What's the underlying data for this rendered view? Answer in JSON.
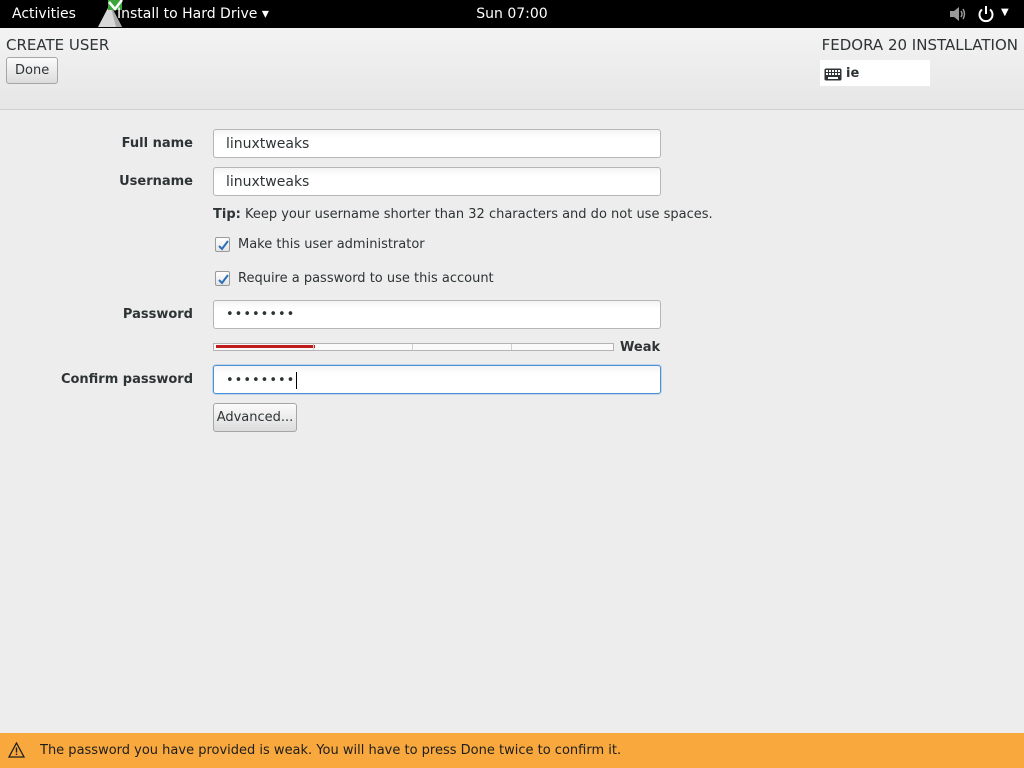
{
  "topbar": {
    "activities": "Activities",
    "app_menu": "Install to Hard Drive ▾",
    "clock": "Sun 07:00",
    "volume_icon": "volume-icon",
    "power_icon": "power-icon"
  },
  "header": {
    "spoke_title": "CREATE USER",
    "done_label": "Done",
    "product_title": "FEDORA 20 INSTALLATION",
    "keyboard_layout": "ie"
  },
  "form": {
    "full_name_label": "Full name",
    "full_name_value": "linuxtweaks",
    "username_label": "Username",
    "username_value": "linuxtweaks",
    "tip_bold": "Tip:",
    "tip_text": " Keep your username shorter than 32 characters and do not use spaces.",
    "admin_label": "Make this user administrator",
    "admin_checked": true,
    "require_password_label": "Require a password to use this account",
    "require_password_checked": true,
    "password_label": "Password",
    "password_value": "••••••••",
    "strength_fraction": 0.25,
    "strength_label": "Weak",
    "confirm_label": "Confirm password",
    "confirm_value": "••••••••",
    "advanced_label": "Advanced..."
  },
  "warning": {
    "text": "The password you have provided is weak. You will have to press Done twice to confirm it.",
    "icon": "warning-icon"
  },
  "colors": {
    "topbar_bg": "#000000",
    "warning_bg": "#f8a83d",
    "strength_weak": "#c01c1c",
    "focus_border": "#4a90d9"
  }
}
